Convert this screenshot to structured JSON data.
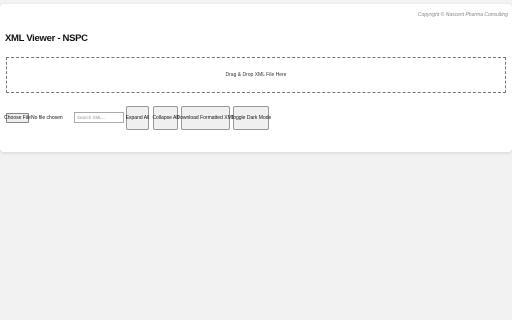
{
  "header": {
    "copyright": "Copyright © Nascent Pharma Consulting",
    "title": "XML Viewer - NSPC"
  },
  "dropzone": {
    "label": "Drag & Drop XML File Here"
  },
  "file_input": {
    "button_label": "Choose File",
    "status": "No file chosen"
  },
  "search": {
    "placeholder": "Search XML..."
  },
  "toolbar": {
    "expand_label": "Expand All",
    "collapse_label": "Collapse All",
    "download_label": "Download Formatted XML",
    "dark_mode_label": "Toggle Dark Mode"
  }
}
